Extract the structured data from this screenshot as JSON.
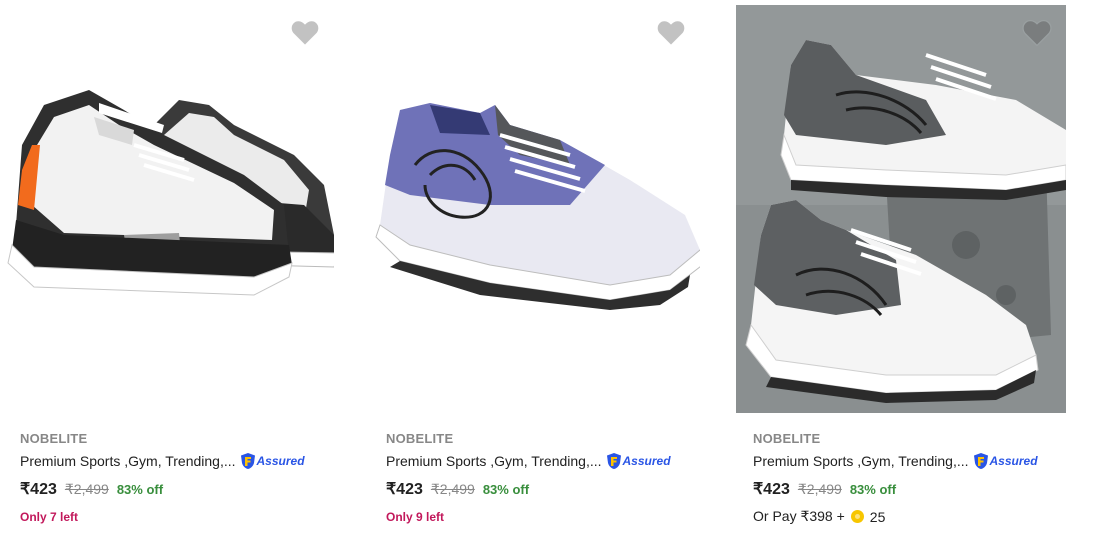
{
  "products": [
    {
      "brand": "NOBELITE",
      "title": "Premium Sports ,Gym, Trending,...",
      "assured_label": "Assured",
      "price": "₹423",
      "mrp": "₹2,499",
      "discount": "83% off",
      "stock_note": "Only 7 left",
      "image_icon": "sneaker-black-white-orange"
    },
    {
      "brand": "NOBELITE",
      "title": "Premium Sports ,Gym, Trending,...",
      "assured_label": "Assured",
      "price": "₹423",
      "mrp": "₹2,499",
      "discount": "83% off",
      "stock_note": "Only 9 left",
      "image_icon": "sneaker-blue-white"
    },
    {
      "brand": "NOBELITE",
      "title": "Premium Sports ,Gym, Trending,...",
      "assured_label": "Assured",
      "price": "₹423",
      "mrp": "₹2,499",
      "discount": "83% off",
      "pay_prefix": "Or Pay ₹398 +",
      "pay_coins": "25",
      "image_icon": "sneaker-pair-grey-white"
    }
  ],
  "colors": {
    "accent_blue": "#2a55e5",
    "discount_green": "#388e3c",
    "stock_pink": "#c2185b",
    "muted_grey": "#878787",
    "heart_grey": "#c2c2c2"
  }
}
